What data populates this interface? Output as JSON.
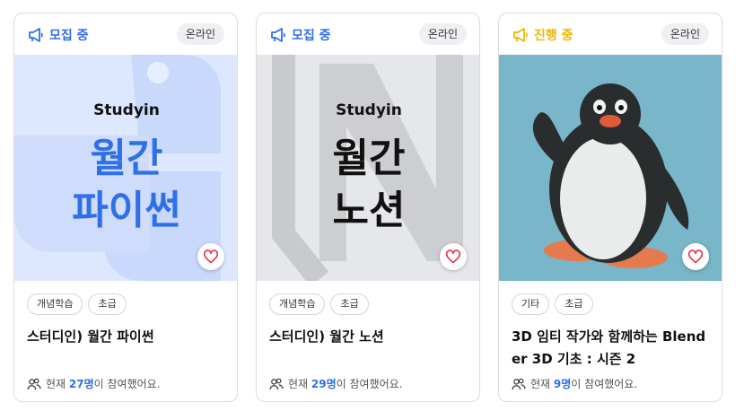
{
  "cards": [
    {
      "status": "모집 중",
      "status_color": "#2f6fe8",
      "status_icon": "megaphone-icon",
      "mode": "온라인",
      "thumbnail": {
        "brand": "Studyin",
        "line1": "월간",
        "line2": "파이썬",
        "bg": "#dde8ff",
        "text_color": "#2f6fe8"
      },
      "tags": [
        "개념학습",
        "초급"
      ],
      "title": "스터디인) 월간 파이썬",
      "participants": {
        "prefix": "현재 ",
        "count": "27명",
        "suffix": "이 참여했어요."
      }
    },
    {
      "status": "모집 중",
      "status_color": "#2f6fe8",
      "status_icon": "megaphone-icon",
      "mode": "온라인",
      "thumbnail": {
        "brand": "Studyin",
        "line1": "월간",
        "line2": "노션",
        "bg": "#e6e7ea",
        "text_color": "#111111"
      },
      "tags": [
        "개념학습",
        "초급"
      ],
      "title": "스터디인) 월간 노션",
      "participants": {
        "prefix": "현재 ",
        "count": "29명",
        "suffix": "이 참여했어요."
      }
    },
    {
      "status": "진행 중",
      "status_color": "#f0b400",
      "status_icon": "megaphone-icon",
      "mode": "온라인",
      "thumbnail": {
        "bg": "#79b6c9"
      },
      "tags": [
        "기타",
        "초급"
      ],
      "title": "3D 임티 작가와 함께하는 Blender 3D 기초 : 시즌 2",
      "participants": {
        "prefix": "현재 ",
        "count": "9명",
        "suffix": "이 참여했어요."
      }
    }
  ]
}
